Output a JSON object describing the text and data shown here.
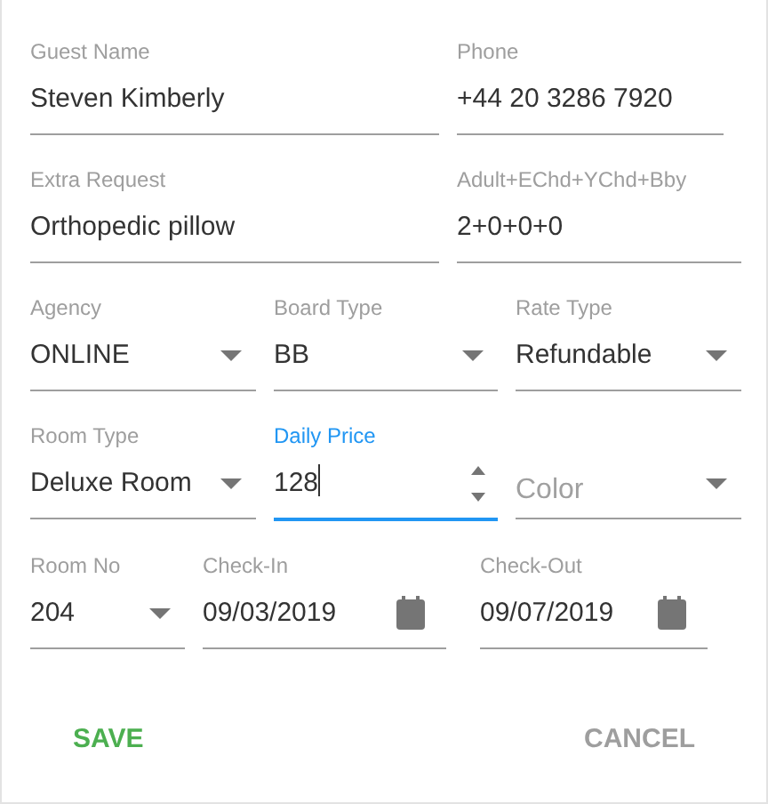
{
  "rows": [
    [
      {
        "kind": "text",
        "label": "Guest Name",
        "value": "Steven Kimberly",
        "focused": false
      },
      {
        "kind": "text",
        "label": "Phone",
        "value": "+44 20 3286 7920",
        "focused": false
      }
    ],
    [
      {
        "kind": "text",
        "label": "Extra Request",
        "value": "Orthopedic pillow",
        "focused": false
      },
      {
        "kind": "text",
        "label": "Adult+EChd+YChd+Bby",
        "value": "2+0+0+0",
        "focused": false
      }
    ],
    [
      {
        "kind": "select",
        "label": "Agency",
        "value": "ONLINE",
        "focused": false
      },
      {
        "kind": "select",
        "label": "Board Type",
        "value": "BB",
        "focused": false
      },
      {
        "kind": "select",
        "label": "Rate Type",
        "value": "Refundable",
        "focused": false
      }
    ],
    [
      {
        "kind": "select",
        "label": "Room Type",
        "value": "Deluxe Room",
        "focused": false
      },
      {
        "kind": "number",
        "label": "Daily Price",
        "value": "128",
        "focused": true
      },
      {
        "kind": "select",
        "placeholder": "Color",
        "focused": false
      }
    ],
    [
      {
        "kind": "select",
        "label": "Room No",
        "value": "204",
        "focused": false
      },
      {
        "kind": "date",
        "label": "Check-In",
        "value": "09/03/2019",
        "focused": false
      },
      {
        "kind": "date",
        "label": "Check-Out",
        "value": "09/07/2019",
        "focused": false
      }
    ]
  ],
  "buttons": [
    {
      "kind": "primary",
      "label": "SAVE"
    },
    {
      "kind": "secondary",
      "label": "CANCEL"
    }
  ]
}
